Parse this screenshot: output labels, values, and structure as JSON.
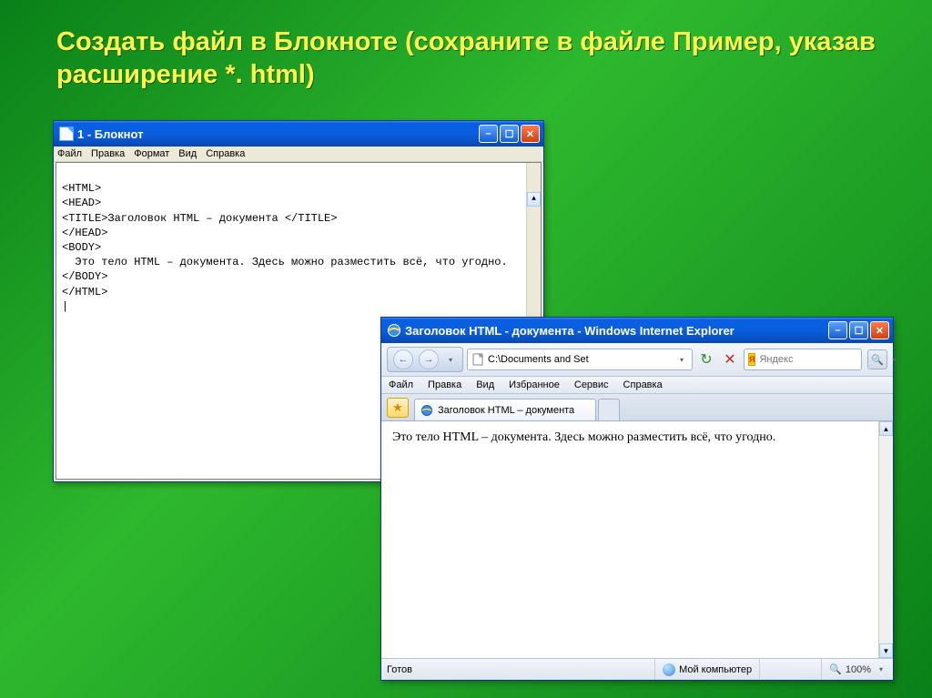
{
  "slide": {
    "title": "Создать файл в Блокноте (сохраните в файле Пример,  указав расширение  *. html)"
  },
  "notepad": {
    "title": "1 - Блокнот",
    "menu": {
      "file": "Файл",
      "edit": "Правка",
      "format": "Формат",
      "view": "Вид",
      "help": "Справка"
    },
    "lines": [
      "<HTML>",
      "<HEAD>",
      "<TITLE>Заголовок HTML – документа </TITLE>",
      "</HEAD>",
      "<BODY>",
      "  Это тело HTML – документа. Здесь можно разместить всё, что угодно.",
      "</BODY>",
      "</HTML>"
    ]
  },
  "ie": {
    "title": "Заголовок HTML - документа - Windows Internet Explorer",
    "address": "C:\\Documents and Set",
    "search_placeholder": "Яндекс",
    "menu": {
      "file": "Файл",
      "edit": "Правка",
      "view": "Вид",
      "favorites": "Избранное",
      "tools": "Сервис",
      "help": "Справка"
    },
    "tab_label": "Заголовок HTML – документа",
    "body_text": "Это тело HTML – документа. Здесь можно разместить всё, что угодно.",
    "status": {
      "ready": "Готов",
      "zone": "Мой компьютер",
      "zoom": "100%"
    }
  }
}
